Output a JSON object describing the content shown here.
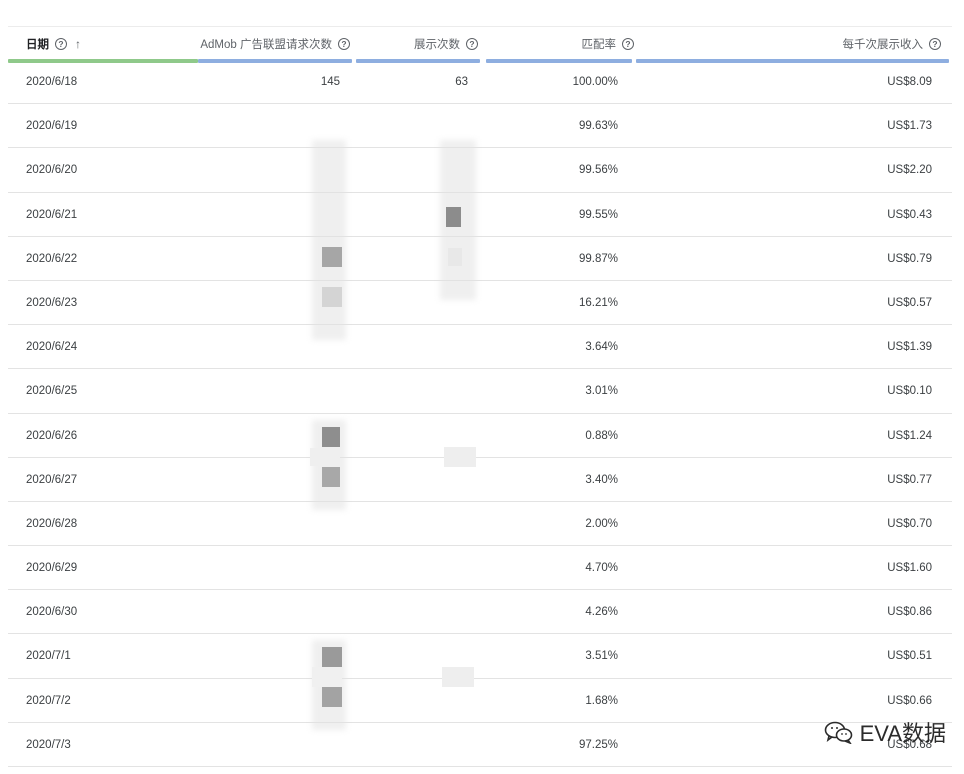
{
  "table": {
    "headers": {
      "date": "日期",
      "requests": "AdMob 广告联盟请求次数",
      "impressions": "展示次数",
      "match_rate": "匹配率",
      "ecpm": "每千次展示收入"
    },
    "help_glyph": "?",
    "sort_arrow": "↑",
    "rows": [
      {
        "date": "2020/6/18",
        "requests": "145",
        "impressions": "63",
        "match_rate": "100.00%",
        "ecpm": "US$8.09"
      },
      {
        "date": "2020/6/19",
        "requests": "",
        "impressions": "",
        "match_rate": "99.63%",
        "ecpm": "US$1.73"
      },
      {
        "date": "2020/6/20",
        "requests": "",
        "impressions": "",
        "match_rate": "99.56%",
        "ecpm": "US$2.20"
      },
      {
        "date": "2020/6/21",
        "requests": "",
        "impressions": "",
        "match_rate": "99.55%",
        "ecpm": "US$0.43"
      },
      {
        "date": "2020/6/22",
        "requests": "",
        "impressions": "",
        "match_rate": "99.87%",
        "ecpm": "US$0.79"
      },
      {
        "date": "2020/6/23",
        "requests": "",
        "impressions": "",
        "match_rate": "16.21%",
        "ecpm": "US$0.57"
      },
      {
        "date": "2020/6/24",
        "requests": "",
        "impressions": "",
        "match_rate": "3.64%",
        "ecpm": "US$1.39"
      },
      {
        "date": "2020/6/25",
        "requests": "",
        "impressions": "",
        "match_rate": "3.01%",
        "ecpm": "US$0.10"
      },
      {
        "date": "2020/6/26",
        "requests": "",
        "impressions": "",
        "match_rate": "0.88%",
        "ecpm": "US$1.24"
      },
      {
        "date": "2020/6/27",
        "requests": "",
        "impressions": "",
        "match_rate": "3.40%",
        "ecpm": "US$0.77"
      },
      {
        "date": "2020/6/28",
        "requests": "",
        "impressions": "",
        "match_rate": "2.00%",
        "ecpm": "US$0.70"
      },
      {
        "date": "2020/6/29",
        "requests": "",
        "impressions": "",
        "match_rate": "4.70%",
        "ecpm": "US$1.60"
      },
      {
        "date": "2020/6/30",
        "requests": "",
        "impressions": "",
        "match_rate": "4.26%",
        "ecpm": "US$0.86"
      },
      {
        "date": "2020/7/1",
        "requests": "",
        "impressions": "",
        "match_rate": "3.51%",
        "ecpm": "US$0.51"
      },
      {
        "date": "2020/7/2",
        "requests": "",
        "impressions": "",
        "match_rate": "1.68%",
        "ecpm": "US$0.66"
      },
      {
        "date": "2020/7/3",
        "requests": "",
        "impressions": "",
        "match_rate": "97.25%",
        "ecpm": "US$0.68"
      }
    ]
  },
  "colors": {
    "date_bar": "#8fc98a",
    "metric_bar": "#8eaee0"
  },
  "watermark": {
    "icon": "wechat-icon",
    "text": "EVA数据"
  }
}
